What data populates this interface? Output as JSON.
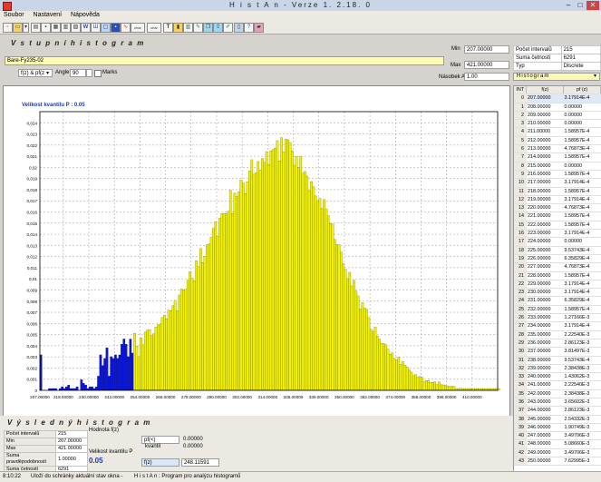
{
  "window": {
    "title": "H i s t A n  -  Verze 1. 2.18. 0"
  },
  "menu": {
    "items": [
      "Soubor",
      "Nastavení",
      "Nápověda"
    ]
  },
  "toolbar": {
    "icons": [
      "new-file-icon",
      "open-file-icon",
      "dropdown-icon",
      "print-icon",
      "save-icon",
      "grid-icon",
      "bar-chart-icon",
      "table-icon",
      "w-icon",
      "frequency-icon",
      "window-icon",
      "save-disk-icon",
      "curve-icon",
      "char-icon",
      "char2-icon",
      "text-icon",
      "palette-icon",
      "bars-icon",
      "brush-icon",
      "copy-icon",
      "export-icon",
      "paint-icon",
      "book-icon",
      "help-icon",
      "eraser-icon"
    ]
  },
  "input_section": {
    "header": "V s t u p n í   h i s t o g r a m",
    "dataset_name": "Bare-Fy235-02",
    "function_select": "f(z) & pf(z",
    "angle_label": "Angle",
    "angle_value": "90",
    "marks_label": "Marks",
    "min_label": "Min",
    "min_value": "207.00000",
    "max_label": "Max",
    "max_value": "421.00000",
    "nasobek_label": "Násobek A",
    "nasobek_value": "1.00"
  },
  "info": {
    "rows": [
      {
        "k": "Počet intervalů",
        "v": "215"
      },
      {
        "k": "Suma četností",
        "v": "6291"
      },
      {
        "k": "Typ",
        "v": "Discrete"
      }
    ],
    "histogram_label": "Histogram"
  },
  "chart_title": "Velikost kvantilu P : 0.05",
  "chart_data": {
    "type": "bar",
    "x_start": 207,
    "x_end": 421,
    "quantile_split": 250,
    "xlim": [
      207,
      421
    ],
    "ylim": [
      0,
      0.025
    ],
    "xticks": [
      "207.00000",
      "218.00000",
      "230.00000",
      "242.00000",
      "254.00000",
      "266.00000",
      "278.00000",
      "290.00000",
      "302.00000",
      "314.00000",
      "326.00000",
      "338.00000",
      "350.00000",
      "362.00000",
      "374.00000",
      "386.00000",
      "398.00000",
      "410.00000"
    ],
    "yticks": [
      "0",
      "0,001",
      "0,002",
      "0,003",
      "0,004",
      "0,005",
      "0,006",
      "0,007",
      "0,008",
      "0,009",
      "0,01",
      "0,011",
      "0,012",
      "0,013",
      "0,014",
      "0,015",
      "0,016",
      "0,017",
      "0,018",
      "0,019",
      "0,02",
      "0,021",
      "0,022",
      "0,023",
      "0,024"
    ],
    "colors": {
      "lower": "#0a18d8",
      "upper": "#f2f200",
      "outline": "#6b6b00"
    },
    "values": [
      0.00318,
      0,
      0,
      0,
      0.00016,
      0.00016,
      0.00016,
      0.00016,
      0,
      0.00016,
      0.00032,
      0.00016,
      0.00032,
      0.00048,
      0.00016,
      0.00016,
      0.00016,
      0.00032,
      0,
      0.00095,
      0.00064,
      0.00048,
      0.00016,
      0.00032,
      0.00032,
      0.00016,
      0.00032,
      0.00127,
      0.00318,
      0.00223,
      0.00286,
      0.00382,
      0.00127,
      0.00302,
      0.00286,
      0.00318,
      0.00286,
      0.00318,
      0.00414,
      0.00461,
      0.00413,
      0.00302,
      0.0046,
      0.00334,
      0.00512,
      0.00398,
      0.00302,
      0.0047,
      0.0041,
      0.00524,
      0.00541,
      0.00545,
      0.0049,
      0.00508,
      0.00569,
      0.00588,
      0.0059,
      0.00653,
      0.00673,
      0.00641,
      0.0072,
      0.00715,
      0.00759,
      0.00808,
      0.00715,
      0.00855,
      0.00909,
      0.00902,
      0.00906,
      0.00989,
      0.01064,
      0.01006,
      0.00983,
      0.01162,
      0.01111,
      0.01272,
      0.01146,
      0.01203,
      0.01306,
      0.01313,
      0.01376,
      0.01452,
      0.01513,
      0.01382,
      0.01543,
      0.01586,
      0.01587,
      0.01584,
      0.01607,
      0.01793,
      0.01586,
      0.01769,
      0.01739,
      0.01782,
      0.01886,
      0.01858,
      0.01766,
      0.0187,
      0.01969,
      0.02069,
      0.01939,
      0.01951,
      0.02053,
      0.01975,
      0.0208,
      0.02045,
      0.02142,
      0.02026,
      0.02148,
      0.0216,
      0.02173,
      0.0224,
      0.02058,
      0.02266,
      0.02139,
      0.02253,
      0.02247,
      0.02223,
      0.02147,
      0.0202,
      0.02097,
      0.01997,
      0.02101,
      0.01948,
      0.01963,
      0.01922,
      0.01791,
      0.01873,
      0.01826,
      0.01745,
      0.01702,
      0.01722,
      0.01633,
      0.01713,
      0.01628,
      0.01566,
      0.01497,
      0.01493,
      0.01353,
      0.01308,
      0.01307,
      0.0124,
      0.01136,
      0.01085,
      0.01002,
      0.01059,
      0.00937,
      0.00988,
      0.00889,
      0.00847,
      0.0073,
      0.00786,
      0.00738,
      0.00727,
      0.00652,
      0.00548,
      0.0053,
      0.00567,
      0.00487,
      0.00459,
      0.00423,
      0.00418,
      0.00409,
      0.00368,
      0.00323,
      0.00336,
      0.00287,
      0.00273,
      0.00298,
      0.00233,
      0.00256,
      0.00226,
      0.0021,
      0.00183,
      0.00163,
      0.00132,
      0.0014,
      0.00118,
      0.00124,
      0.00117,
      0.00078,
      0.00087,
      0.00088,
      0.00071,
      0.00072,
      0.00077,
      0.00052,
      0.00074,
      0.0005,
      0.00049,
      0.00044,
      0.00038,
      0.00033,
      0.00037,
      0.00034,
      0.00016,
      0.00012,
      0.00019,
      0.00016,
      0.00016,
      0.00016,
      0.00016,
      0.00016,
      0.00016,
      0.00016,
      0.00016,
      0.00016,
      0.00016,
      0.00016,
      0.00016,
      0.00016,
      0.00016,
      0.00016,
      0.00016,
      0.00016,
      0.00016
    ]
  },
  "table": {
    "headers": [
      "INT",
      "f(z)",
      "pf (z)"
    ],
    "rows": [
      [
        "0",
        "207.00000",
        "3.17914E-4"
      ],
      [
        "1",
        "208.00000",
        "0.00000"
      ],
      [
        "2",
        "209.00000",
        "0.00000"
      ],
      [
        "3",
        "210.00000",
        "0.00000"
      ],
      [
        "4",
        "211.00000",
        "1.58957E-4"
      ],
      [
        "5",
        "212.00000",
        "1.58957E-4"
      ],
      [
        "6",
        "213.00000",
        "4.76873E-4"
      ],
      [
        "7",
        "214.00000",
        "1.58957E-4"
      ],
      [
        "8",
        "215.00000",
        "0.00000"
      ],
      [
        "9",
        "216.00000",
        "1.58957E-4"
      ],
      [
        "10",
        "217.00000",
        "3.17914E-4"
      ],
      [
        "11",
        "218.00000",
        "1.58957E-4"
      ],
      [
        "12",
        "219.00000",
        "3.17914E-4"
      ],
      [
        "13",
        "220.00000",
        "4.76873E-4"
      ],
      [
        "14",
        "221.00000",
        "1.58957E-4"
      ],
      [
        "15",
        "222.00000",
        "1.58957E-4"
      ],
      [
        "16",
        "223.00000",
        "3.17914E-4"
      ],
      [
        "17",
        "224.00000",
        "0.00000"
      ],
      [
        "18",
        "225.00000",
        "9.53743E-4"
      ],
      [
        "19",
        "226.00000",
        "6.35829E-4"
      ],
      [
        "20",
        "227.00000",
        "4.76873E-4"
      ],
      [
        "21",
        "228.00000",
        "1.58957E-4"
      ],
      [
        "22",
        "229.00000",
        "3.17914E-4"
      ],
      [
        "23",
        "230.00000",
        "3.17914E-4"
      ],
      [
        "24",
        "231.00000",
        "6.35829E-4"
      ],
      [
        "25",
        "232.00000",
        "1.58957E-4"
      ],
      [
        "26",
        "233.00000",
        "1.27166E-3"
      ],
      [
        "27",
        "234.00000",
        "3.17914E-4"
      ],
      [
        "28",
        "235.00000",
        "2.22540E-3"
      ],
      [
        "29",
        "236.00000",
        "2.86123E-3"
      ],
      [
        "30",
        "237.00000",
        "3.81497E-3"
      ],
      [
        "31",
        "238.00000",
        "9.53743E-4"
      ],
      [
        "32",
        "239.00000",
        "2.38438E-3"
      ],
      [
        "33",
        "240.00000",
        "1.43062E-3"
      ],
      [
        "34",
        "241.00000",
        "2.22540E-3"
      ],
      [
        "35",
        "242.00000",
        "2.38438E-3"
      ],
      [
        "36",
        "243.00000",
        "3.65602E-3"
      ],
      [
        "37",
        "244.00000",
        "2.86123E-3"
      ],
      [
        "38",
        "245.00000",
        "2.54332E-3"
      ],
      [
        "39",
        "246.00000",
        "1.90749E-3"
      ],
      [
        "40",
        "247.00000",
        "3.49706E-3"
      ],
      [
        "41",
        "248.00000",
        "5.08660E-3"
      ],
      [
        "42",
        "249.00000",
        "3.49706E-3"
      ],
      [
        "43",
        "250.00000",
        "7.62995E-3"
      ]
    ]
  },
  "result_section": {
    "header": "V ý s l e d n ý   h i s t o g r a m",
    "rows": [
      {
        "k": "Počet intervalů",
        "v": "215"
      },
      {
        "k": "Min",
        "v": "207.00000"
      },
      {
        "k": "Max",
        "v": "421.00000"
      },
      {
        "k": "Suma pravděpodobností",
        "v": "1.00000"
      },
      {
        "k": "Suma četností",
        "v": "6291"
      }
    ],
    "hodnota_label": "Hodnota f(z)",
    "kvantil_label": "Velikost kvantilu P",
    "kvantil_value": "0.05",
    "pf_label": "pf(<)",
    "pf_value": "0.00000",
    "kvantil2_label": "kvantil",
    "kvantil2_value": "0.00000",
    "fz_label": "f(z)",
    "fz_value": "248.11591"
  },
  "status": {
    "time": "8:10:22",
    "message": "Uloží do schránky aktuální stav okna -",
    "app": "H i s t A n :   Program pro analýzu histogramů"
  }
}
